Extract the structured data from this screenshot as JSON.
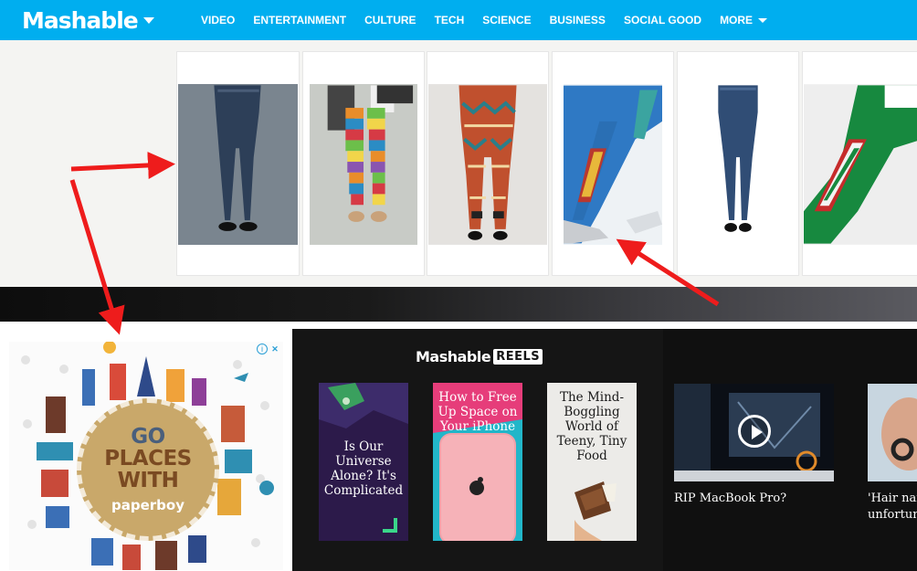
{
  "header": {
    "logo": "Mashable",
    "nav": [
      "VIDEO",
      "ENTERTAINMENT",
      "CULTURE",
      "TECH",
      "SCIENCE",
      "BUSINESS",
      "SOCIAL GOOD"
    ],
    "more_label": "MORE",
    "background": "#00aeef"
  },
  "products": [
    {
      "name": "denim-print-leggings"
    },
    {
      "name": "striped-multicolor-leggings"
    },
    {
      "name": "tribal-print-leggings"
    },
    {
      "name": "blue-kente-stripe-leggings"
    },
    {
      "name": "skinny-blue-jeans"
    },
    {
      "name": "green-stripe-leggings"
    }
  ],
  "ad": {
    "headline_lines": [
      "GO",
      "PLACES",
      "WITH"
    ],
    "brand": "paperboy",
    "choices": [
      "i",
      "✕"
    ]
  },
  "reels": {
    "logo": "Mashable",
    "tag": "REELS",
    "cards": [
      {
        "text": "Is Our Universe Alone? It's Complicated"
      },
      {
        "text": "How to Free Up Space on Your iPhone"
      },
      {
        "text": "The Mind-Boggling World of Teeny, Tiny Food"
      }
    ]
  },
  "videos": [
    {
      "caption": "RIP MacBook Pro?"
    },
    {
      "caption_lines": [
        "'Hair nail",
        "unfortun"
      ]
    }
  ],
  "colors": {
    "accent": "#00aeef",
    "annotation_arrow": "#ee1c1c",
    "reels_bg": "#151515"
  }
}
